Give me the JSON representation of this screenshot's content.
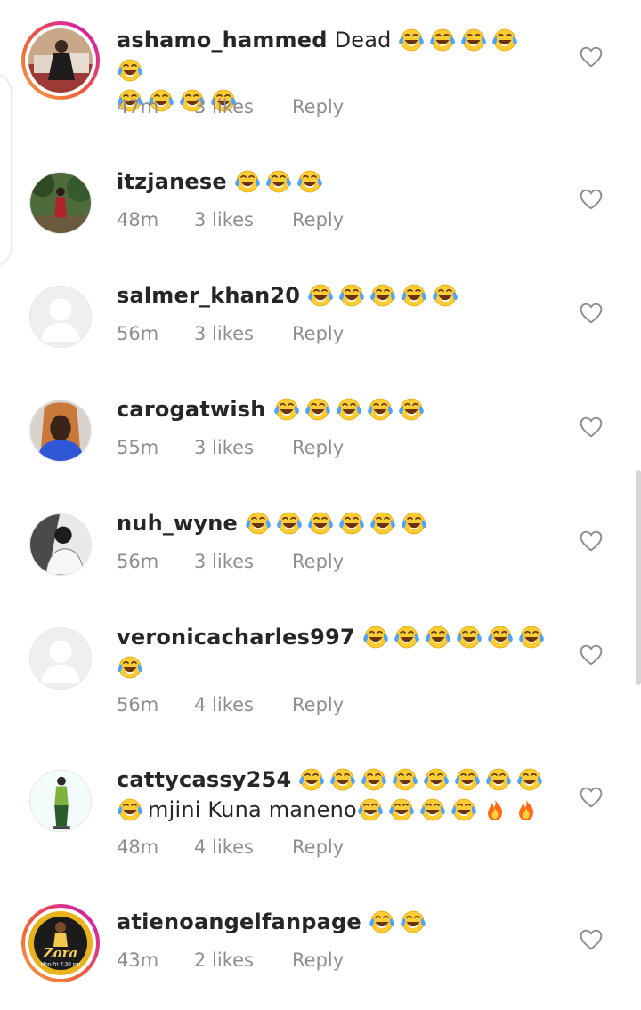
{
  "comments": [
    {
      "username": "ashamo_hammed",
      "text_parts": [
        "Dead",
        "😂😂😂😂😂",
        "😂😂😂😂"
      ],
      "time": "47m",
      "likes": "3 likes",
      "reply": "Reply",
      "avatar": "photo-woman-red-room",
      "story_ring": true
    },
    {
      "username": "itzjanese",
      "text_parts": [
        "😂😂😂"
      ],
      "time": "48m",
      "likes": "3 likes",
      "reply": "Reply",
      "avatar": "photo-person-in-garden",
      "story_ring": false
    },
    {
      "username": "salmer_khan20",
      "text_parts": [
        "😂😂😂😂😂"
      ],
      "time": "56m",
      "likes": "3 likes",
      "reply": "Reply",
      "avatar": "default-avatar",
      "story_ring": false
    },
    {
      "username": "carogatwish",
      "text_parts": [
        "😂😂😂😂😂"
      ],
      "time": "55m",
      "likes": "3 likes",
      "reply": "Reply",
      "avatar": "photo-woman-blue-top",
      "story_ring": false
    },
    {
      "username": "nuh_wyne",
      "text_parts": [
        "😂😂😂😂😂😂"
      ],
      "time": "56m",
      "likes": "3 likes",
      "reply": "Reply",
      "avatar": "photo-man-black-white",
      "story_ring": false
    },
    {
      "username": "veronicacharles997",
      "text_parts": [
        "😂😂😂😂😂😂",
        "😂"
      ],
      "time": "56m",
      "likes": "4 likes",
      "reply": "Reply",
      "avatar": "default-avatar",
      "story_ring": false
    },
    {
      "username": "cattycassy254",
      "text_parts": [
        "😂😂😂😂😂😂😂😂",
        "😂mjini Kuna maneno😂😂😂😂🔥🔥"
      ],
      "time": "48m",
      "likes": "4 likes",
      "reply": "Reply",
      "avatar": "photo-person-standing",
      "story_ring": false
    },
    {
      "username": "atienoangelfanpage",
      "text_parts": [
        "😂😂"
      ],
      "time": "43m",
      "likes": "2 likes",
      "reply": "Reply",
      "avatar": "photo-zora-show-logo",
      "story_ring": true,
      "avatar_text": "Zora",
      "avatar_subtext": "Mon-Fri 7:30 pm"
    }
  ],
  "icons": {
    "like": "heart-outline-icon",
    "laugh": "face-with-tears-of-joy-emoji",
    "fire": "fire-emoji"
  },
  "colors": {
    "text": "#262626",
    "meta": "#8e8e8e",
    "story_ring_start": "#f9a03f",
    "story_ring_end": "#b330b0"
  }
}
